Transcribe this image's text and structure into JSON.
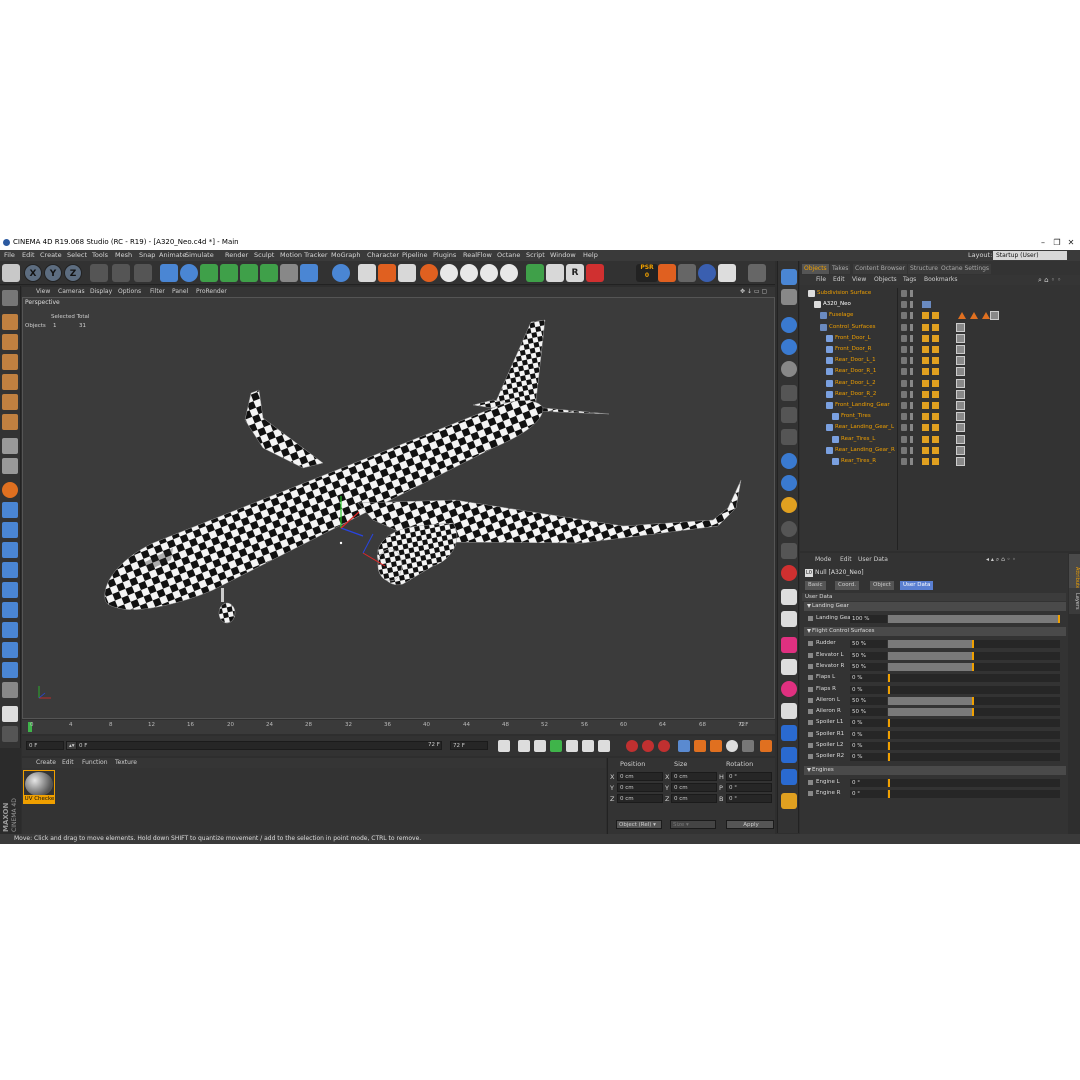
{
  "window": {
    "title": "CINEMA 4D R19.068 Studio (RC - R19) - [A320_Neo.c4d *] - Main"
  },
  "menubar": [
    "File",
    "Edit",
    "Create",
    "Select",
    "Tools",
    "Mesh",
    "Snap",
    "Animate",
    "Simulate",
    "Render",
    "Sculpt",
    "Motion Tracker",
    "MoGraph",
    "Character",
    "Pipeline",
    "Plugins",
    "RealFlow",
    "Octane",
    "Script",
    "Window",
    "Help"
  ],
  "layout": {
    "label": "Layout:",
    "value": "Startup (User)"
  },
  "toolbar": {
    "x": "X",
    "y": "Y",
    "z": "Z",
    "psr_label": "PSR",
    "psr_value": "0"
  },
  "viewport": {
    "menu": [
      "View",
      "Cameras",
      "Display",
      "Options",
      "Filter",
      "Panel",
      "ProRender"
    ],
    "name": "Perspective",
    "stats": {
      "header": "Selected Total",
      "label": "Objects",
      "selected": "1",
      "total": "31"
    }
  },
  "timeline": {
    "ticks": [
      "0",
      "4",
      "8",
      "12",
      "16",
      "20",
      "24",
      "28",
      "32",
      "36",
      "40",
      "44",
      "48",
      "52",
      "56",
      "60",
      "64",
      "68",
      "72"
    ],
    "end_label": "0 F",
    "current": "0 F",
    "range_start": "0 F",
    "range_end": "72 F",
    "max": "72 F"
  },
  "material_manager": {
    "menu": [
      "Create",
      "Edit",
      "Function",
      "Texture"
    ],
    "material_name": "UV Checke"
  },
  "coordinates": {
    "headers": [
      "Position",
      "Size",
      "Rotation"
    ],
    "rows": [
      {
        "axis": "X",
        "pos": "0 cm",
        "saxis": "X",
        "size": "0 cm",
        "raxis": "H",
        "rot": "0 °"
      },
      {
        "axis": "Y",
        "pos": "0 cm",
        "saxis": "Y",
        "size": "0 cm",
        "raxis": "P",
        "rot": "0 °"
      },
      {
        "axis": "Z",
        "pos": "0 cm",
        "saxis": "Z",
        "size": "0 cm",
        "raxis": "B",
        "rot": "0 °"
      }
    ],
    "mode": "Object (Rel) ▾",
    "size_mode": "Size ▾",
    "apply": "Apply"
  },
  "status": "Move: Click and drag to move elements. Hold down SHIFT to quantize movement / add to the selection in point mode, CTRL to remove.",
  "maxon": {
    "line1": "MAXON",
    "line2": "CINEMA 4D"
  },
  "object_manager": {
    "tabs": [
      "Objects",
      "Takes",
      "Content Browser",
      "Structure",
      "Octane Settings"
    ],
    "menu": [
      "File",
      "Edit",
      "View",
      "Objects",
      "Tags",
      "Bookmarks"
    ],
    "objects": [
      {
        "name": "Subdivision Surface",
        "indent": 0,
        "selected": false
      },
      {
        "name": "A320_Neo",
        "indent": 1,
        "selected": true
      },
      {
        "name": "Fuselage",
        "indent": 2,
        "selected": false
      },
      {
        "name": "Control_Surfaces",
        "indent": 2,
        "selected": false
      },
      {
        "name": "Front_Door_L",
        "indent": 3,
        "selected": false
      },
      {
        "name": "Front_Door_R",
        "indent": 3,
        "selected": false
      },
      {
        "name": "Rear_Door_L_1",
        "indent": 3,
        "selected": false
      },
      {
        "name": "Rear_Door_R_1",
        "indent": 3,
        "selected": false
      },
      {
        "name": "Rear_Door_L_2",
        "indent": 3,
        "selected": false
      },
      {
        "name": "Rear_Door_R_2",
        "indent": 3,
        "selected": false
      },
      {
        "name": "Front_Landing_Gear",
        "indent": 3,
        "selected": false
      },
      {
        "name": "Front_Tires",
        "indent": 4,
        "selected": false
      },
      {
        "name": "Rear_Landing_Gear_L",
        "indent": 3,
        "selected": false
      },
      {
        "name": "Rear_Tires_L",
        "indent": 4,
        "selected": false
      },
      {
        "name": "Rear_Landing_Gear_R",
        "indent": 3,
        "selected": false
      },
      {
        "name": "Rear_Tires_R",
        "indent": 4,
        "selected": false
      }
    ]
  },
  "attribute_manager": {
    "menu": [
      "Mode",
      "Edit",
      "User Data"
    ],
    "object": "Null [A320_Neo]",
    "tabs": [
      "Basic",
      "Coord.",
      "Object",
      "User Data"
    ],
    "active_tab": "User Data",
    "section": "User Data",
    "groups": [
      {
        "title": "Landing Gear",
        "params": [
          {
            "label": "Landing Gear",
            "value": "100 %",
            "fraction": 1.0
          }
        ]
      },
      {
        "title": "Flight Control Surfaces",
        "params": [
          {
            "label": "Rudder",
            "value": "50 %",
            "fraction": 0.5
          },
          {
            "label": "Elevator L",
            "value": "50 %",
            "fraction": 0.5
          },
          {
            "label": "Elevator R",
            "value": "50 %",
            "fraction": 0.5
          },
          {
            "label": "Flaps L",
            "value": "0 %",
            "fraction": 0.0
          },
          {
            "label": "Flaps R",
            "value": "0 %",
            "fraction": 0.0
          },
          {
            "label": "Aileron L",
            "value": "50 %",
            "fraction": 0.5
          },
          {
            "label": "Aileron R",
            "value": "50 %",
            "fraction": 0.5
          },
          {
            "label": "Spoiler L1",
            "value": "0 %",
            "fraction": 0.0
          },
          {
            "label": "Spoiler R1",
            "value": "0 %",
            "fraction": 0.0
          },
          {
            "label": "Spoiler L2",
            "value": "0 %",
            "fraction": 0.0
          },
          {
            "label": "Spoiler R2",
            "value": "0 %",
            "fraction": 0.0
          }
        ]
      },
      {
        "title": "Engines",
        "params": [
          {
            "label": "Engine L",
            "value": "0 °",
            "fraction": 0.0
          },
          {
            "label": "Engine R",
            "value": "0 °",
            "fraction": 0.0
          }
        ]
      }
    ],
    "side_tabs": [
      "Attributes",
      "Layers"
    ]
  },
  "colors": {
    "accent": "#f0a000",
    "selection": "#5a7fd1",
    "background": "#2e2e2e"
  }
}
